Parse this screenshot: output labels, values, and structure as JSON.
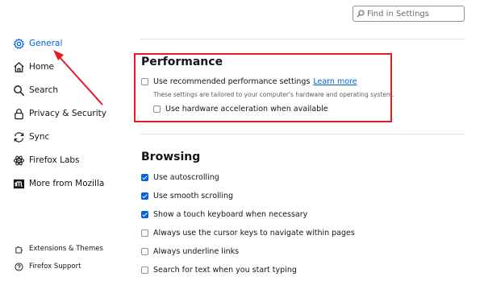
{
  "search": {
    "placeholder": "Find in Settings"
  },
  "sidebar": {
    "items": [
      {
        "label": "General",
        "icon": "gear-icon",
        "selected": true
      },
      {
        "label": "Home",
        "icon": "home-icon"
      },
      {
        "label": "Search",
        "icon": "search-icon"
      },
      {
        "label": "Privacy & Security",
        "icon": "lock-icon"
      },
      {
        "label": "Sync",
        "icon": "sync-icon"
      },
      {
        "label": "Firefox Labs",
        "icon": "labs-icon"
      },
      {
        "label": "More from Mozilla",
        "icon": "mozilla-icon"
      }
    ],
    "footer": [
      {
        "label": "Extensions & Themes",
        "icon": "extensions-icon"
      },
      {
        "label": "Firefox Support",
        "icon": "help-icon"
      }
    ]
  },
  "performance": {
    "title": "Performance",
    "recommended_label": "Use recommended performance settings",
    "recommended_checked": false,
    "learn_more": "Learn more",
    "description": "These settings are tailored to your computer's hardware and operating system.",
    "hw_accel_label": "Use hardware acceleration when available",
    "hw_accel_checked": false
  },
  "browsing": {
    "title": "Browsing",
    "options": [
      {
        "label": "Use autoscrolling",
        "checked": true
      },
      {
        "label": "Use smooth scrolling",
        "checked": true
      },
      {
        "label": "Show a touch keyboard when necessary",
        "checked": true
      },
      {
        "label": "Always use the cursor keys to navigate within pages",
        "checked": false
      },
      {
        "label": "Always underline links",
        "checked": false
      },
      {
        "label": "Search for text when you start typing",
        "checked": false
      }
    ]
  },
  "colors": {
    "accent": "#0061e0",
    "annotation": "#e41b23"
  }
}
